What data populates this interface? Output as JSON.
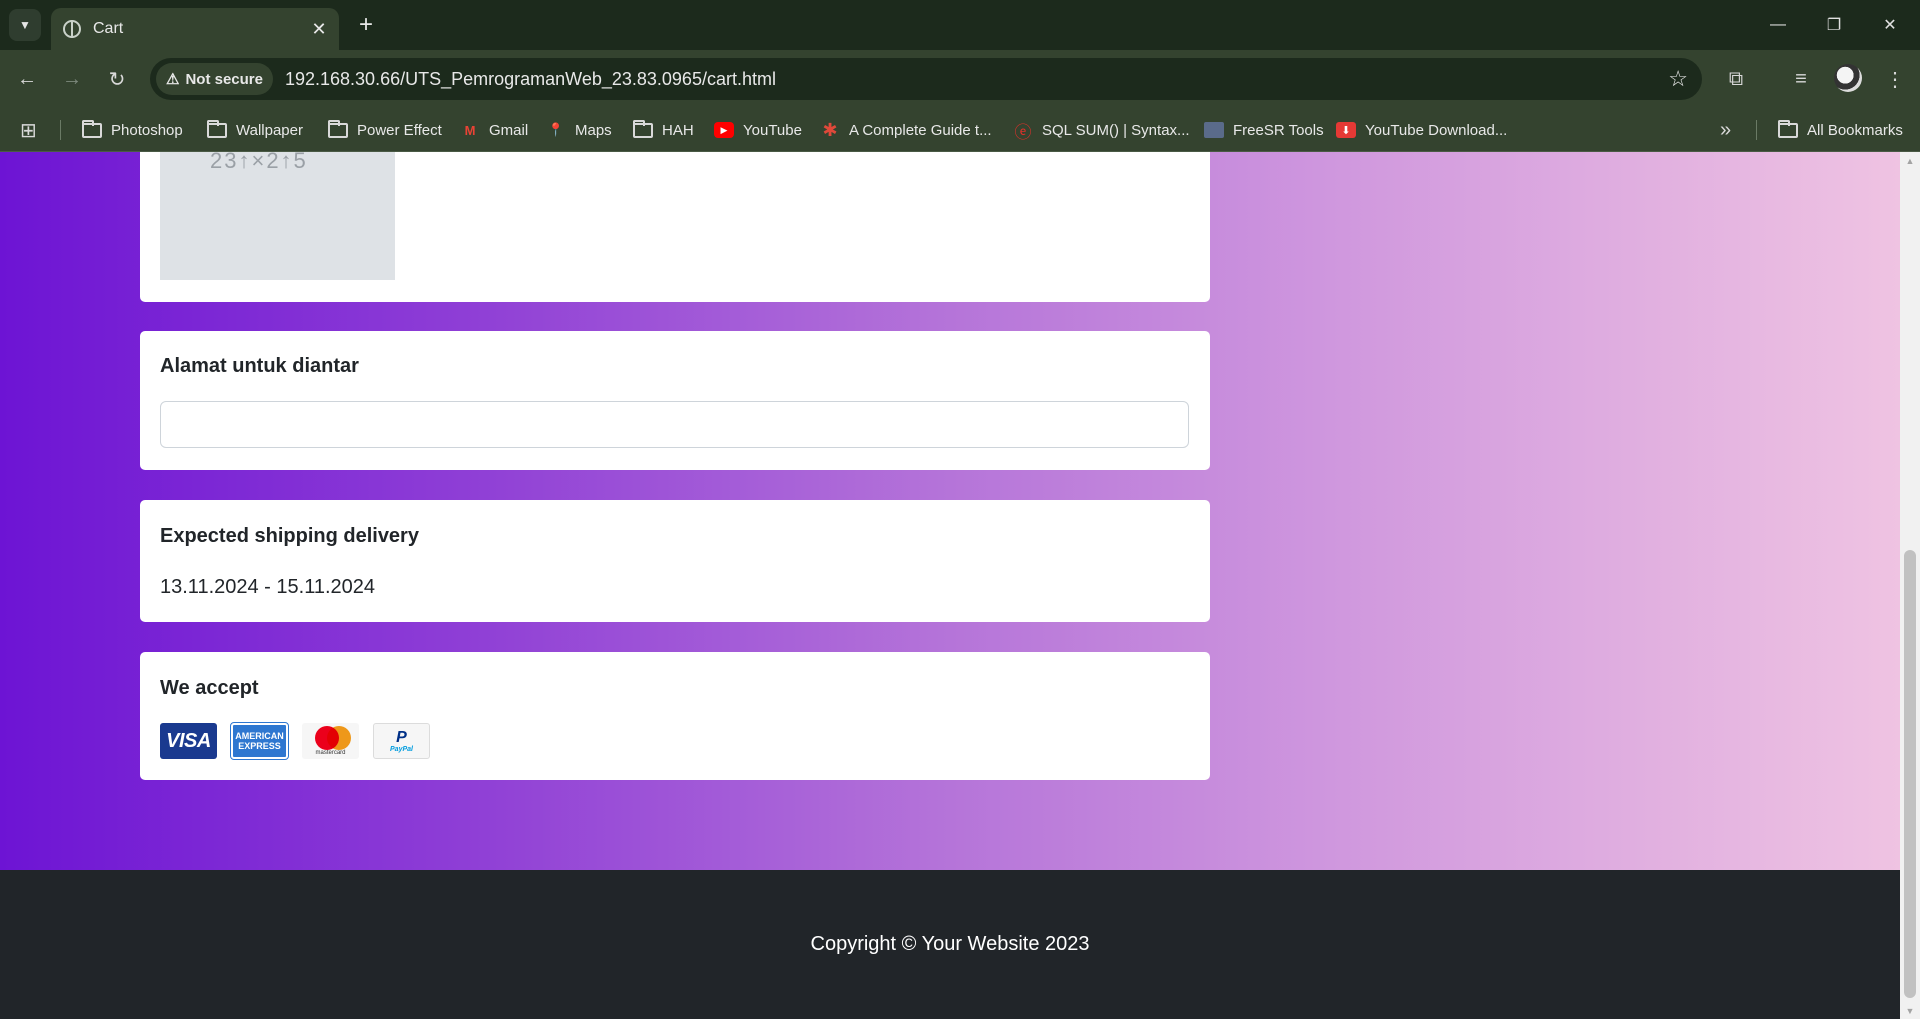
{
  "browser": {
    "tab_title": "Cart",
    "security_label": "Not secure",
    "url_host": "192.168.30.66",
    "url_path": "/UTS_PemrogramanWeb_23.83.0965/cart.html",
    "icons": {
      "tab_menu": "chevron-down-icon",
      "tab_close": "close-icon",
      "new_tab": "plus-icon",
      "back": "back-arrow-icon",
      "forward": "forward-arrow-icon",
      "reload": "reload-icon",
      "bookmark_star": "star-icon",
      "extensions": "puzzle-icon",
      "media": "media-control-icon",
      "menu": "kebab-menu-icon"
    }
  },
  "bookmarks": {
    "items": [
      {
        "label": "Photoshop",
        "icon": "folder-icon"
      },
      {
        "label": "Wallpaper",
        "icon": "folder-icon"
      },
      {
        "label": "Power Effect",
        "icon": "folder-icon"
      },
      {
        "label": "Gmail",
        "icon": "gmail-icon"
      },
      {
        "label": "Maps",
        "icon": "maps-icon"
      },
      {
        "label": "HAH",
        "icon": "folder-icon"
      },
      {
        "label": "YouTube",
        "icon": "youtube-icon"
      },
      {
        "label": "A Complete Guide t...",
        "icon": "asterisk-icon"
      },
      {
        "label": "SQL SUM() | Syntax...",
        "icon": "sql-icon"
      },
      {
        "label": "FreeSR Tools",
        "icon": "freesr-icon"
      },
      {
        "label": "YouTube Download...",
        "icon": "download-icon"
      }
    ],
    "all_bookmarks": "All Bookmarks"
  },
  "page": {
    "product_image_text": "23↑×2↑5",
    "address_card": {
      "title": "Alamat untuk diantar",
      "input_value": ""
    },
    "shipping_card": {
      "title": "Expected shipping delivery",
      "dates": "13.11.2024 - 15.11.2024"
    },
    "payment_card": {
      "title": "We accept",
      "methods": [
        {
          "name": "VISA",
          "label": "VISA"
        },
        {
          "name": "American Express",
          "label": "AMERICAN EXPRESS"
        },
        {
          "name": "Mastercard",
          "label": "mastercard"
        },
        {
          "name": "PayPal",
          "label": "PayPal"
        }
      ]
    },
    "footer_text": "Copyright © Your Website 2023"
  },
  "colors": {
    "gradient_start": "#6d14d4",
    "gradient_end": "#efc3e2",
    "footer_bg": "#212529",
    "chrome_bg": "#34432f"
  }
}
